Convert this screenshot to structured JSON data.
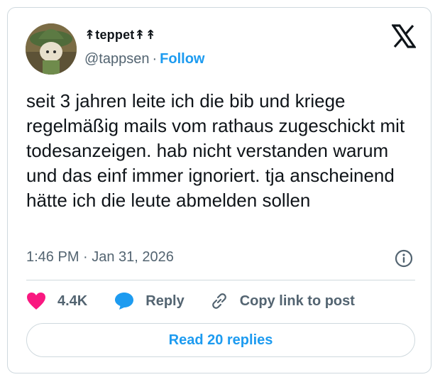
{
  "author": {
    "display_name": "↟teppet↟↟",
    "handle": "@tappsen",
    "follow_label": "Follow"
  },
  "tweet": {
    "text": "seit 3 jahren leite ich die bib und kriege regelmäßig mails vom rathaus zugeschickt mit todesanzeigen. hab nicht verstanden warum und das einf immer ignoriert. tja anscheinend hätte ich die leute abmelden sollen",
    "time": "1:46 PM · Jan 31, 2026"
  },
  "actions": {
    "like_count": "4.4K",
    "reply_label": "Reply",
    "copy_label": "Copy link to post"
  },
  "read_replies_label": "Read 20 replies",
  "colors": {
    "accent": "#1d9bf0",
    "like": "#f91880",
    "secondary_text": "#536471",
    "border": "#cfd9de"
  },
  "icons": {
    "logo": "x-logo-icon",
    "info": "info-icon",
    "like": "heart-icon",
    "reply": "speech-bubble-icon",
    "copy": "link-icon"
  }
}
